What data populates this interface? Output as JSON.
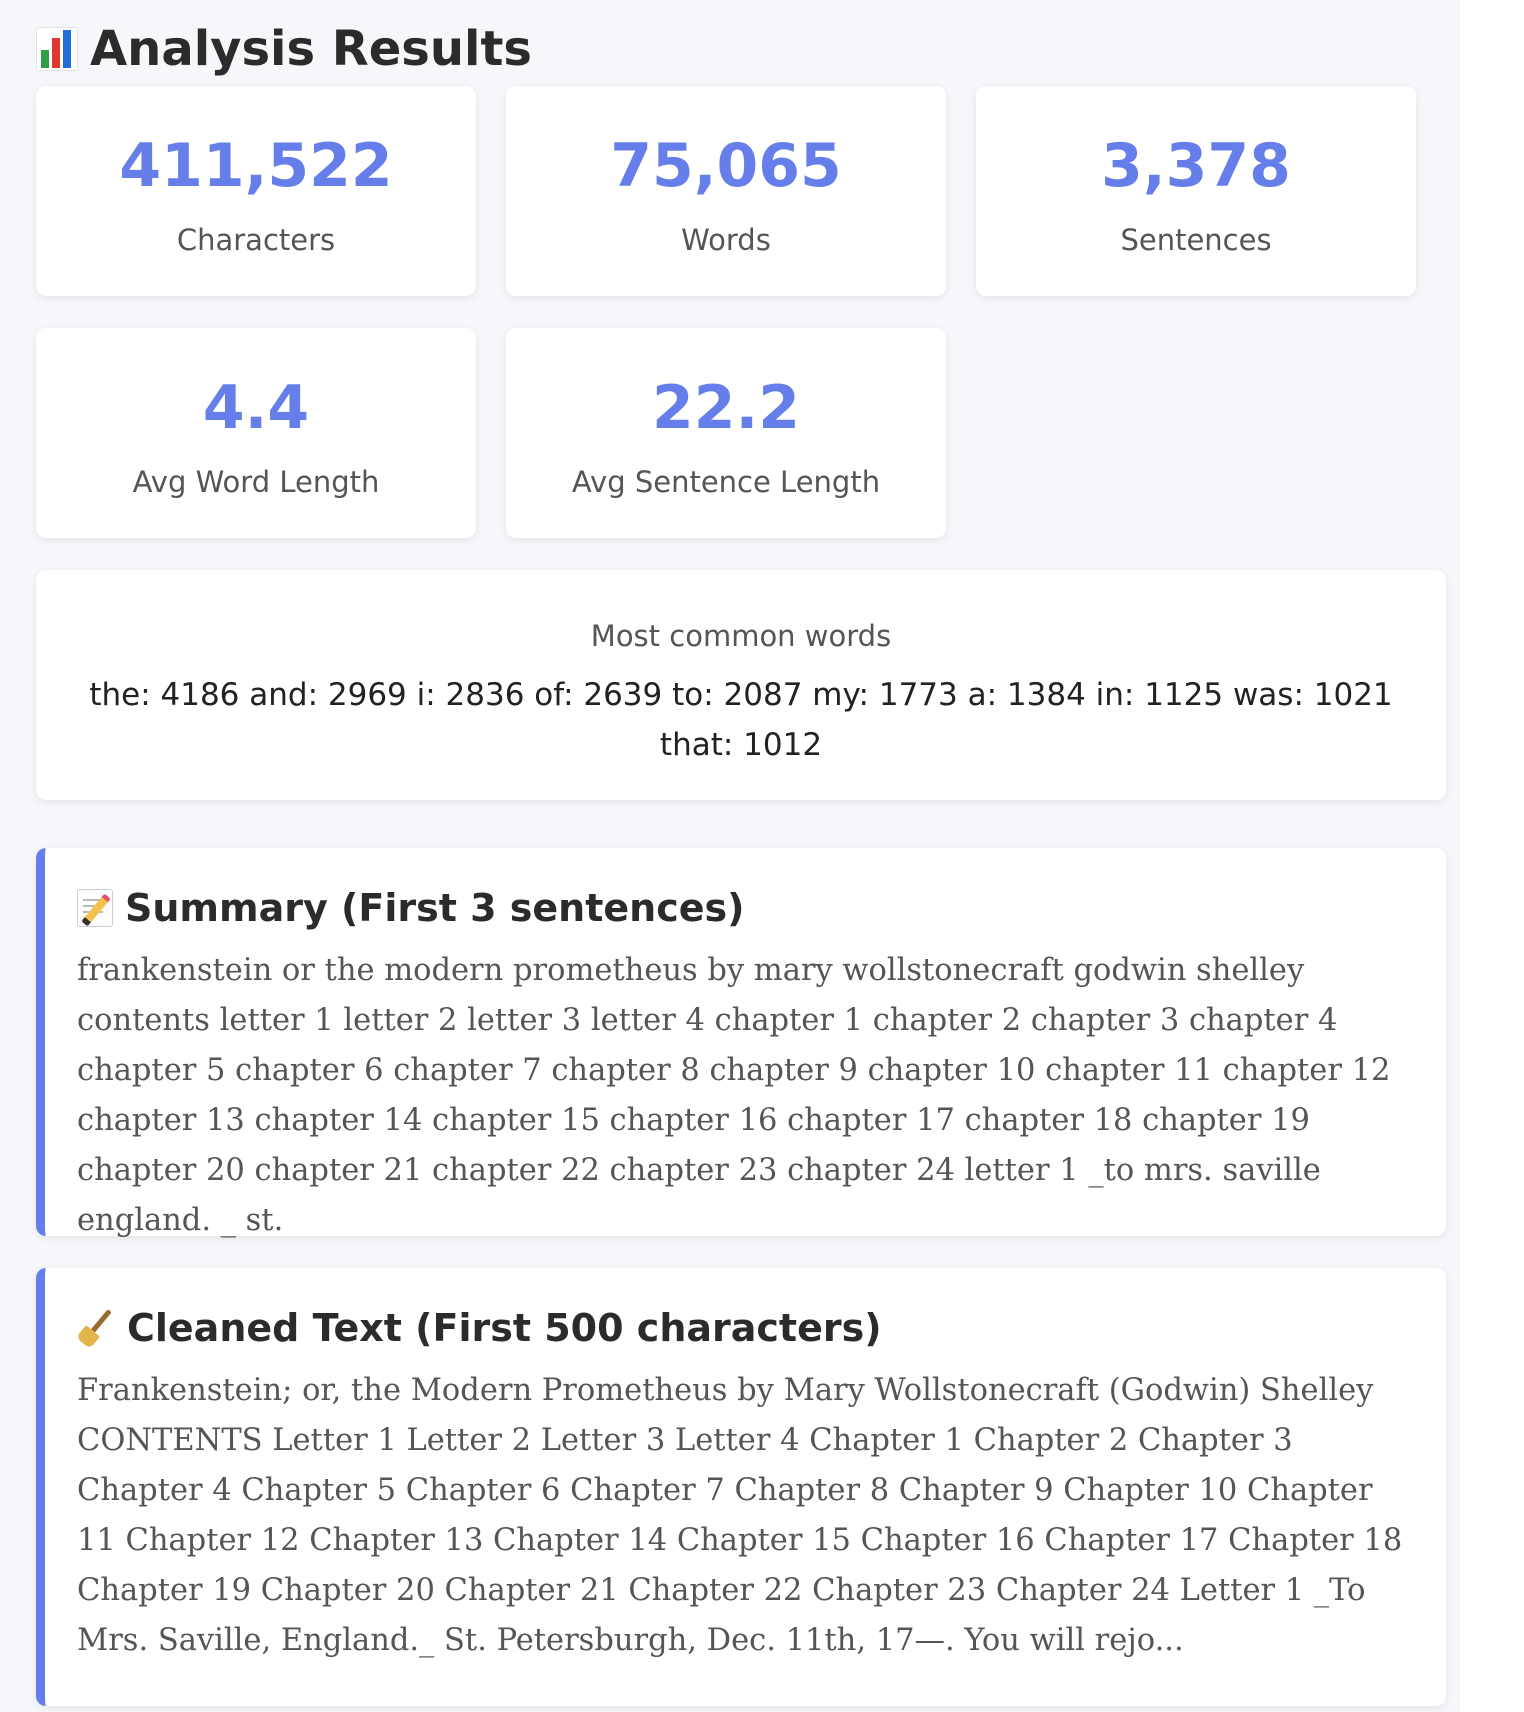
{
  "header": {
    "title": "Analysis Results",
    "icon": "bar-chart-icon"
  },
  "stats": {
    "characters": {
      "value": "411,522",
      "label": "Characters"
    },
    "words": {
      "value": "75,065",
      "label": "Words"
    },
    "sentences": {
      "value": "3,378",
      "label": "Sentences"
    },
    "avg_word_length": {
      "value": "4.4",
      "label": "Avg Word Length"
    },
    "avg_sentence_length": {
      "value": "22.2",
      "label": "Avg Sentence Length"
    }
  },
  "common_words": {
    "label": "Most common words",
    "values": "the: 4186 and: 2969 i: 2836 of: 2639 to: 2087 my: 1773 a: 1384 in: 1125 was: 1021 that: 1012"
  },
  "summary": {
    "icon": "memo-icon",
    "title": "Summary (First 3 sentences)",
    "text": "frankenstein or the modern prometheus by mary wollstonecraft godwin shelley contents letter 1 letter 2 letter 3 letter 4 chapter 1 chapter 2 chapter 3 chapter 4 chapter 5 chapter 6 chapter 7 chapter 8 chapter 9 chapter 10 chapter 11 chapter 12 chapter 13 chapter 14 chapter 15 chapter 16 chapter 17 chapter 18 chapter 19 chapter 20 chapter 21 chapter 22 chapter 23 chapter 24 letter 1 _to mrs. saville england. _ st."
  },
  "cleaned": {
    "icon": "broom-icon",
    "title": "Cleaned Text (First 500 characters)",
    "text": "Frankenstein; or, the Modern Prometheus by Mary Wollstonecraft (Godwin) Shelley CONTENTS Letter 1 Letter 2 Letter 3 Letter 4 Chapter 1 Chapter 2 Chapter 3 Chapter 4 Chapter 5 Chapter 6 Chapter 7 Chapter 8 Chapter 9 Chapter 10 Chapter 11 Chapter 12 Chapter 13 Chapter 14 Chapter 15 Chapter 16 Chapter 17 Chapter 18 Chapter 19 Chapter 20 Chapter 21 Chapter 22 Chapter 23 Chapter 24 Letter 1 _To Mrs. Saville, England._ St. Petersburgh, Dec. 11th, 17—. You will rejo..."
  },
  "colors": {
    "accent": "#667eea",
    "background": "#f5f7fa",
    "card": "#ffffff"
  }
}
